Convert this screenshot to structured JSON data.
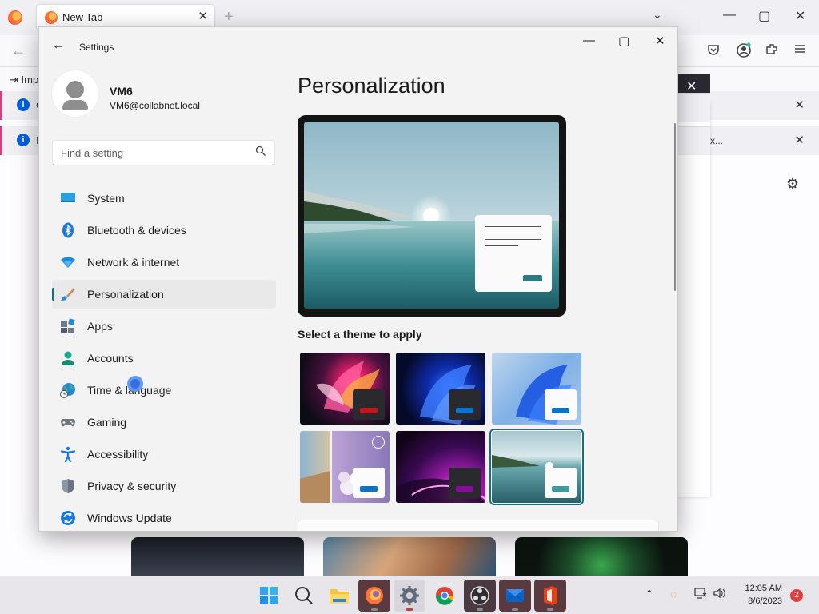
{
  "firefox": {
    "tab_title": "New Tab",
    "tab_close": "✕",
    "new_tab": "+",
    "list_tabs": "⌄",
    "back": "←",
    "import_label": "Imp",
    "notif_prefix_1": "C",
    "notif_prefix_2": "I",
    "notif_info": "i",
    "notif_close": "✕",
    "panel_suffix": "x..."
  },
  "window_controls": {
    "minimize": "—",
    "maximize": "▢",
    "close": "✕"
  },
  "settings": {
    "app_title": "Settings",
    "back": "←",
    "user": {
      "name": "VM6",
      "email": "VM6@collabnet.local"
    },
    "search": {
      "placeholder": "Find a setting"
    },
    "nav": [
      {
        "label": "System",
        "icon": "system-icon"
      },
      {
        "label": "Bluetooth & devices",
        "icon": "bluetooth-icon"
      },
      {
        "label": "Network & internet",
        "icon": "wifi-icon"
      },
      {
        "label": "Personalization",
        "icon": "brush-icon",
        "active": true
      },
      {
        "label": "Apps",
        "icon": "apps-icon"
      },
      {
        "label": "Accounts",
        "icon": "accounts-icon"
      },
      {
        "label": "Time & language",
        "icon": "globe-clock-icon"
      },
      {
        "label": "Gaming",
        "icon": "gamepad-icon"
      },
      {
        "label": "Accessibility",
        "icon": "accessibility-icon"
      },
      {
        "label": "Privacy & security",
        "icon": "shield-icon"
      },
      {
        "label": "Windows Update",
        "icon": "update-icon"
      }
    ],
    "page_title": "Personalization",
    "theme_section_label": "Select a theme to apply",
    "themes": [
      {
        "name": "glow",
        "accent": "#c4141e"
      },
      {
        "name": "windows-dark",
        "accent": "#0a74cc"
      },
      {
        "name": "windows-light",
        "accent": "#0a74cc"
      },
      {
        "name": "spotlight",
        "accent": "#0a74cc"
      },
      {
        "name": "captured-motion",
        "accent": "#8a0aa0"
      },
      {
        "name": "flow",
        "accent": "#3a9ca0",
        "selected": true
      }
    ]
  },
  "taskbar": {
    "apps": [
      "start-icon",
      "search-icon",
      "file-explorer-icon",
      "firefox-icon",
      "settings-icon",
      "chrome-icon",
      "obs-icon",
      "mail-icon",
      "office-icon"
    ],
    "clock_time": "12:05 AM",
    "clock_date": "8/6/2023",
    "notification_count": "2"
  },
  "colors": {
    "accent": "#1b6e7a",
    "window_bg": "#f3f3f3"
  }
}
